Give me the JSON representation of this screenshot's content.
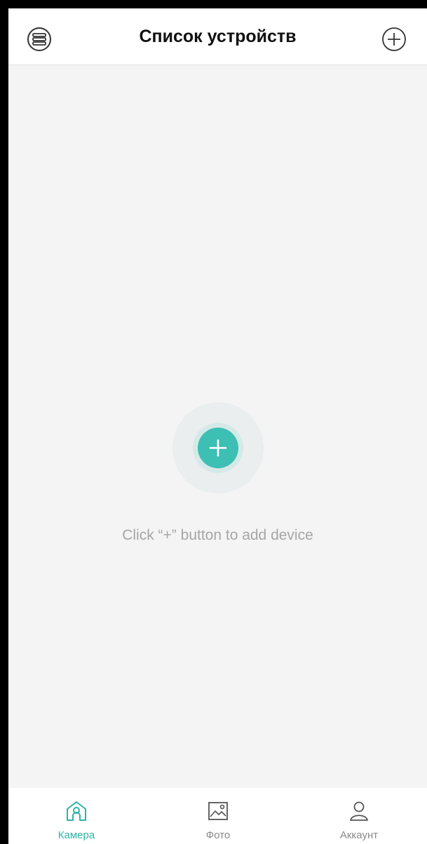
{
  "header": {
    "title": "Список устройств",
    "menu_icon": "menu-list-icon",
    "add_icon": "plus-circle-icon"
  },
  "empty_state": {
    "add_icon": "plus-icon",
    "hint": "Click “+” button to add device"
  },
  "tabbar": {
    "active": "camera",
    "tabs": [
      {
        "id": "camera",
        "label": "Камера",
        "icon": "home-camera-icon"
      },
      {
        "id": "photo",
        "label": "Фото",
        "icon": "image-icon"
      },
      {
        "id": "account",
        "label": "Аккаунт",
        "icon": "user-icon"
      }
    ]
  },
  "colors": {
    "accent": "#3dbfb3",
    "active_tab": "#2fb3a8",
    "inactive_tab": "#8a8a8a",
    "background": "#f4f4f4",
    "hint_text": "#a6a6a6"
  }
}
